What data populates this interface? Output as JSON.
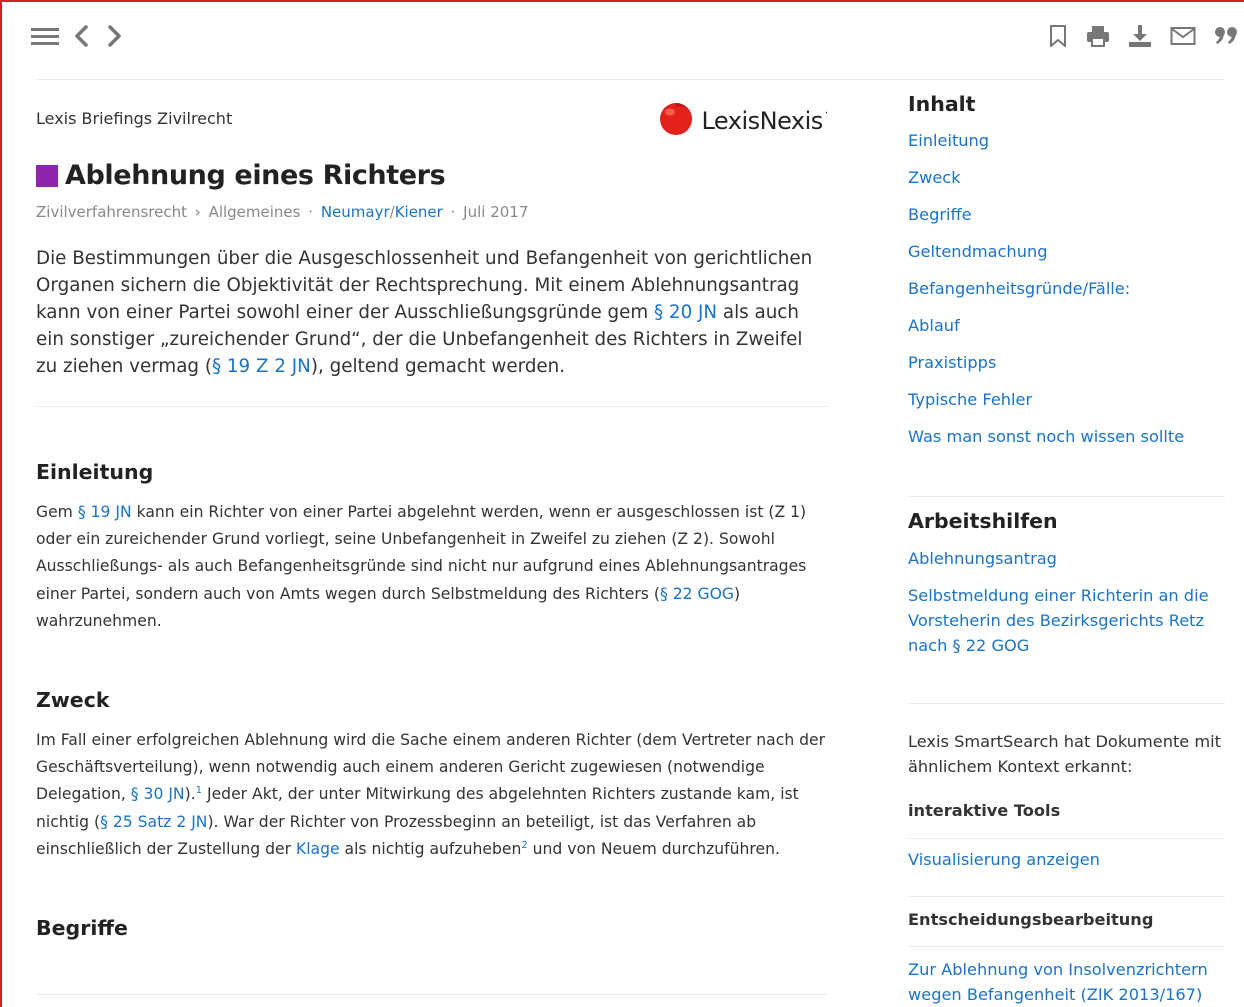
{
  "toolbar": {
    "left_icons": [
      "hamburger-menu-icon",
      "chevron-left-icon",
      "chevron-right-icon"
    ],
    "right_icons": [
      "bookmark-icon",
      "print-icon",
      "download-icon",
      "mail-icon",
      "quote-icon"
    ]
  },
  "document": {
    "series": "Lexis Briefings Zivilrecht",
    "logo_text": "LexisNexis",
    "logo_mark": "·",
    "title": "Ablehnung eines Richters",
    "title_color": "#8e24aa",
    "breadcrumb": {
      "area": "Zivilverfahrensrecht",
      "arrow": "›",
      "category": "Allgemeines",
      "dot1": "·",
      "author1": "Neumayr",
      "slash": "/",
      "author2": "Kiener",
      "dot2": "·",
      "date": "Juli 2017"
    },
    "lead": {
      "t1": "Die Bestimmungen über die Ausgeschlossenheit und Befangenheit von gerichtlichen Organen sichern die Objektivität der Rechtsprechung. Mit einem Ablehnungsantrag kann von einer Partei sowohl einer der Ausschließungsgründe gem ",
      "l1": "§ 20 JN",
      "t2": " als auch ein sonstiger „zureichender Grund“, der die Unbefangenheit des Richters in Zweifel zu ziehen vermag (",
      "l2": "§ 19 Z 2 JN",
      "t3": "), geltend gemacht werden."
    },
    "sections": {
      "einleitung": {
        "title": "Einleitung",
        "t1": "Gem ",
        "l1": "§ 19 JN",
        "t2": " kann ein Richter von einer Partei abgelehnt werden, wenn er ausgeschlossen ist (Z 1) oder ein zureichender Grund vorliegt, seine Unbefangenheit in Zweifel zu ziehen (Z 2). Sowohl Ausschließungs- als auch Befangenheitsgründe sind nicht nur aufgrund eines Ablehnungsantrages einer Partei, sondern auch von Amts wegen durch Selbstmeldung des Richters (",
        "l2": "§ 22 GOG",
        "t3": ") wahrzunehmen."
      },
      "zweck": {
        "title": "Zweck",
        "t1": "Im Fall einer erfolgreichen Ablehnung wird die Sache einem anderen Richter (dem Vertreter nach der Geschäftsverteilung), wenn notwendig auch einem anderen Gericht zugewiesen (notwendige Delegation, ",
        "l1": "§ 30 JN",
        "t2": ").",
        "fn1": "1",
        "t3": " Jeder Akt, der unter Mitwirkung des abgelehnten Richters zustande kam, ist nichtig (",
        "l2": "§ 25 Satz 2 JN",
        "t4": "). War der Richter von Prozessbeginn an beteiligt, ist das Verfahren ab einschließlich der Zustellung der ",
        "l3": "Klage",
        "t5": " als nichtig aufzuheben",
        "fn2": "2",
        "t6": " und von Neuem durchzuführen."
      },
      "begriffe": {
        "title": "Begriffe"
      }
    }
  },
  "sidebar": {
    "inhalt": {
      "heading": "Inhalt",
      "items": [
        "Einleitung",
        "Zweck",
        "Begriffe",
        "Geltendmachung",
        "Befangenheitsgründe/Fälle:",
        "Ablauf",
        "Praxistipps",
        "Typische Fehler",
        "Was man sonst noch wissen sollte"
      ]
    },
    "arbeitshilfen": {
      "heading": "Arbeitshilfen",
      "items": [
        "Ablehnungsantrag",
        "Selbstmeldung einer Richterin an die Vorsteherin des Bezirksgerichts Retz nach § 22 GOG"
      ]
    },
    "smartsearch": {
      "intro": "Lexis SmartSearch hat Dokumente mit ähnlichem Kontext erkannt:",
      "tools_heading": "interaktive Tools",
      "tools_link": "Visualisierung anzeigen",
      "decisions_heading": "Entscheidungsbearbeitung",
      "decisions_link": "Zur Ablehnung von Insolvenzrichtern wegen Befangenheit (ZIK 2013/167)"
    }
  },
  "colors": {
    "link": "#1a73c8",
    "frame": "#d81e2a",
    "logo_red": "#e3221b",
    "icon_gray": "#777777"
  }
}
